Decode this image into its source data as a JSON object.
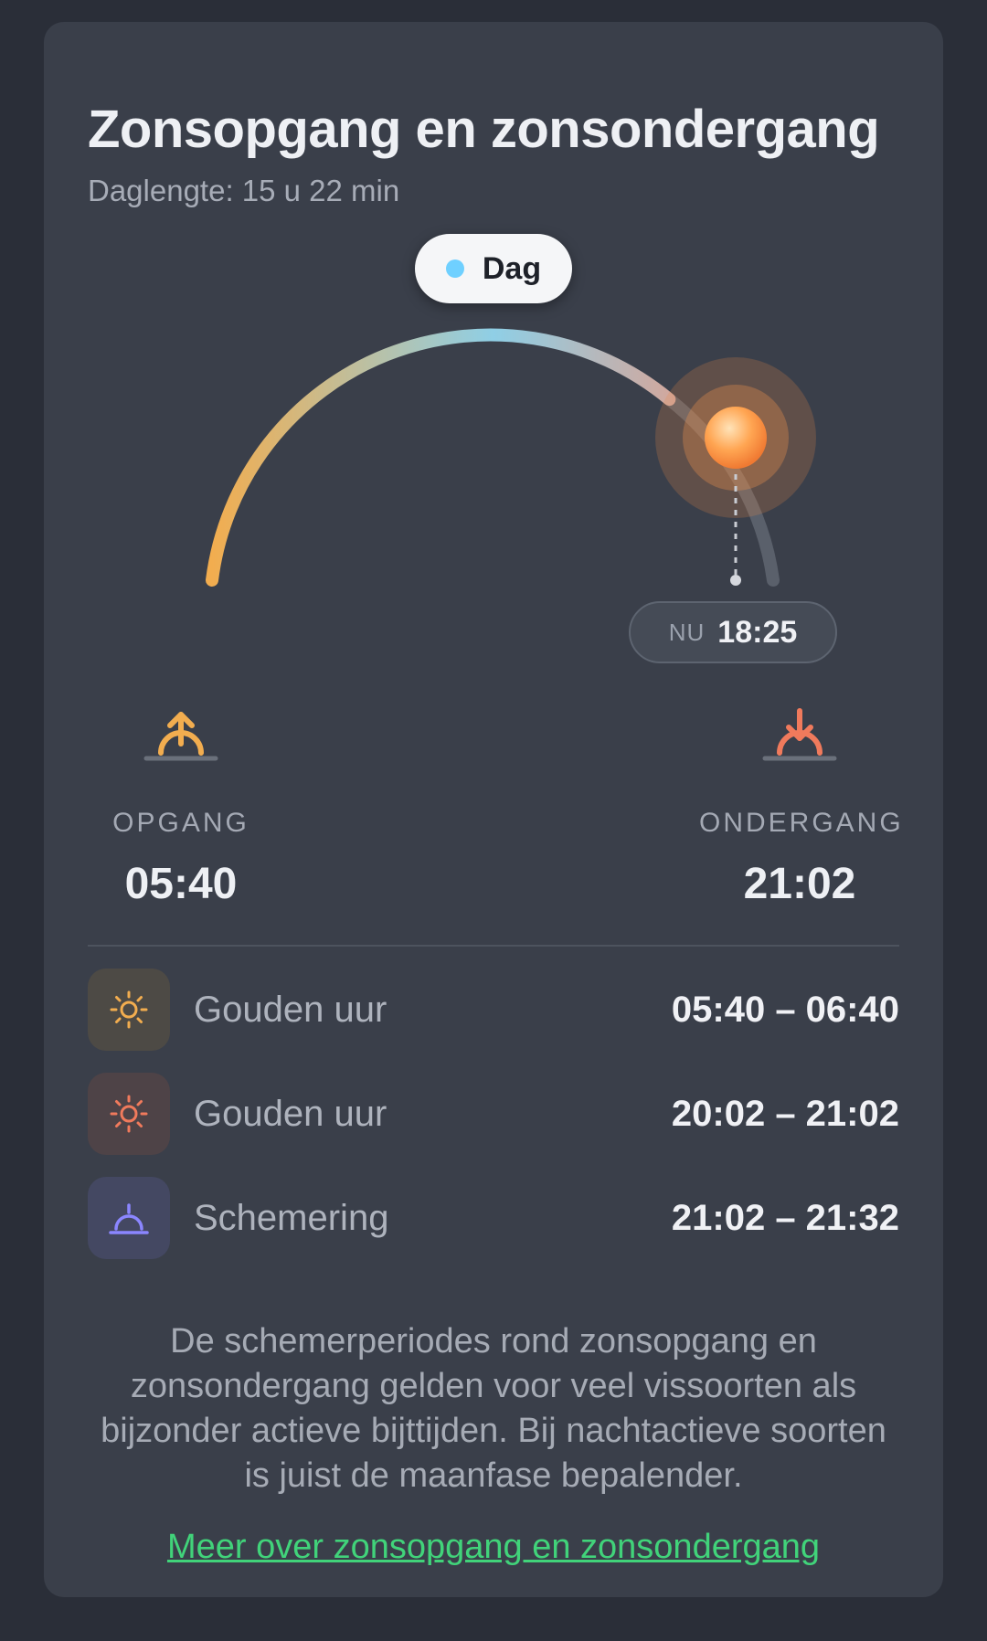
{
  "card": {
    "title": "Zonsopgang en zonsondergang",
    "subtitle": "Daglengte: 15 u 22 min"
  },
  "sun_arc": {
    "phase_label": "Dag",
    "phase_dot_color": "#6fd0ff",
    "now_label": "NU",
    "now_time": "18:25",
    "gradient_colors": [
      "#f2ad4f",
      "#8fcfe6",
      "#e79b86"
    ],
    "sun_color": "#ffa552"
  },
  "sunrise": {
    "label": "OPGANG",
    "time": "05:40",
    "icon": "sunrise-icon",
    "color": "#f2ad4f"
  },
  "sunset": {
    "label": "ONDERGANG",
    "time": "21:02",
    "icon": "sunset-icon",
    "color": "#f07a5c"
  },
  "periods": [
    {
      "label": "Gouden uur",
      "time": "05:40 – 06:40",
      "icon": "sun-icon",
      "color": "#f2ad4f"
    },
    {
      "label": "Gouden uur",
      "time": "20:02 – 21:02",
      "icon": "sun-icon",
      "color": "#f07a5c"
    },
    {
      "label": "Schemering",
      "time": "21:02 – 21:32",
      "icon": "twilight-icon",
      "color": "#8b86ff"
    }
  ],
  "note": "De schemerperiodes rond zonsopgang en zonsondergang gelden voor veel vissoorten als bijzonder actieve bijttijden. Bij nachtactieve soorten is juist de maanfase bepalender.",
  "more_link": "Meer over zonsopgang en zonsondergang"
}
